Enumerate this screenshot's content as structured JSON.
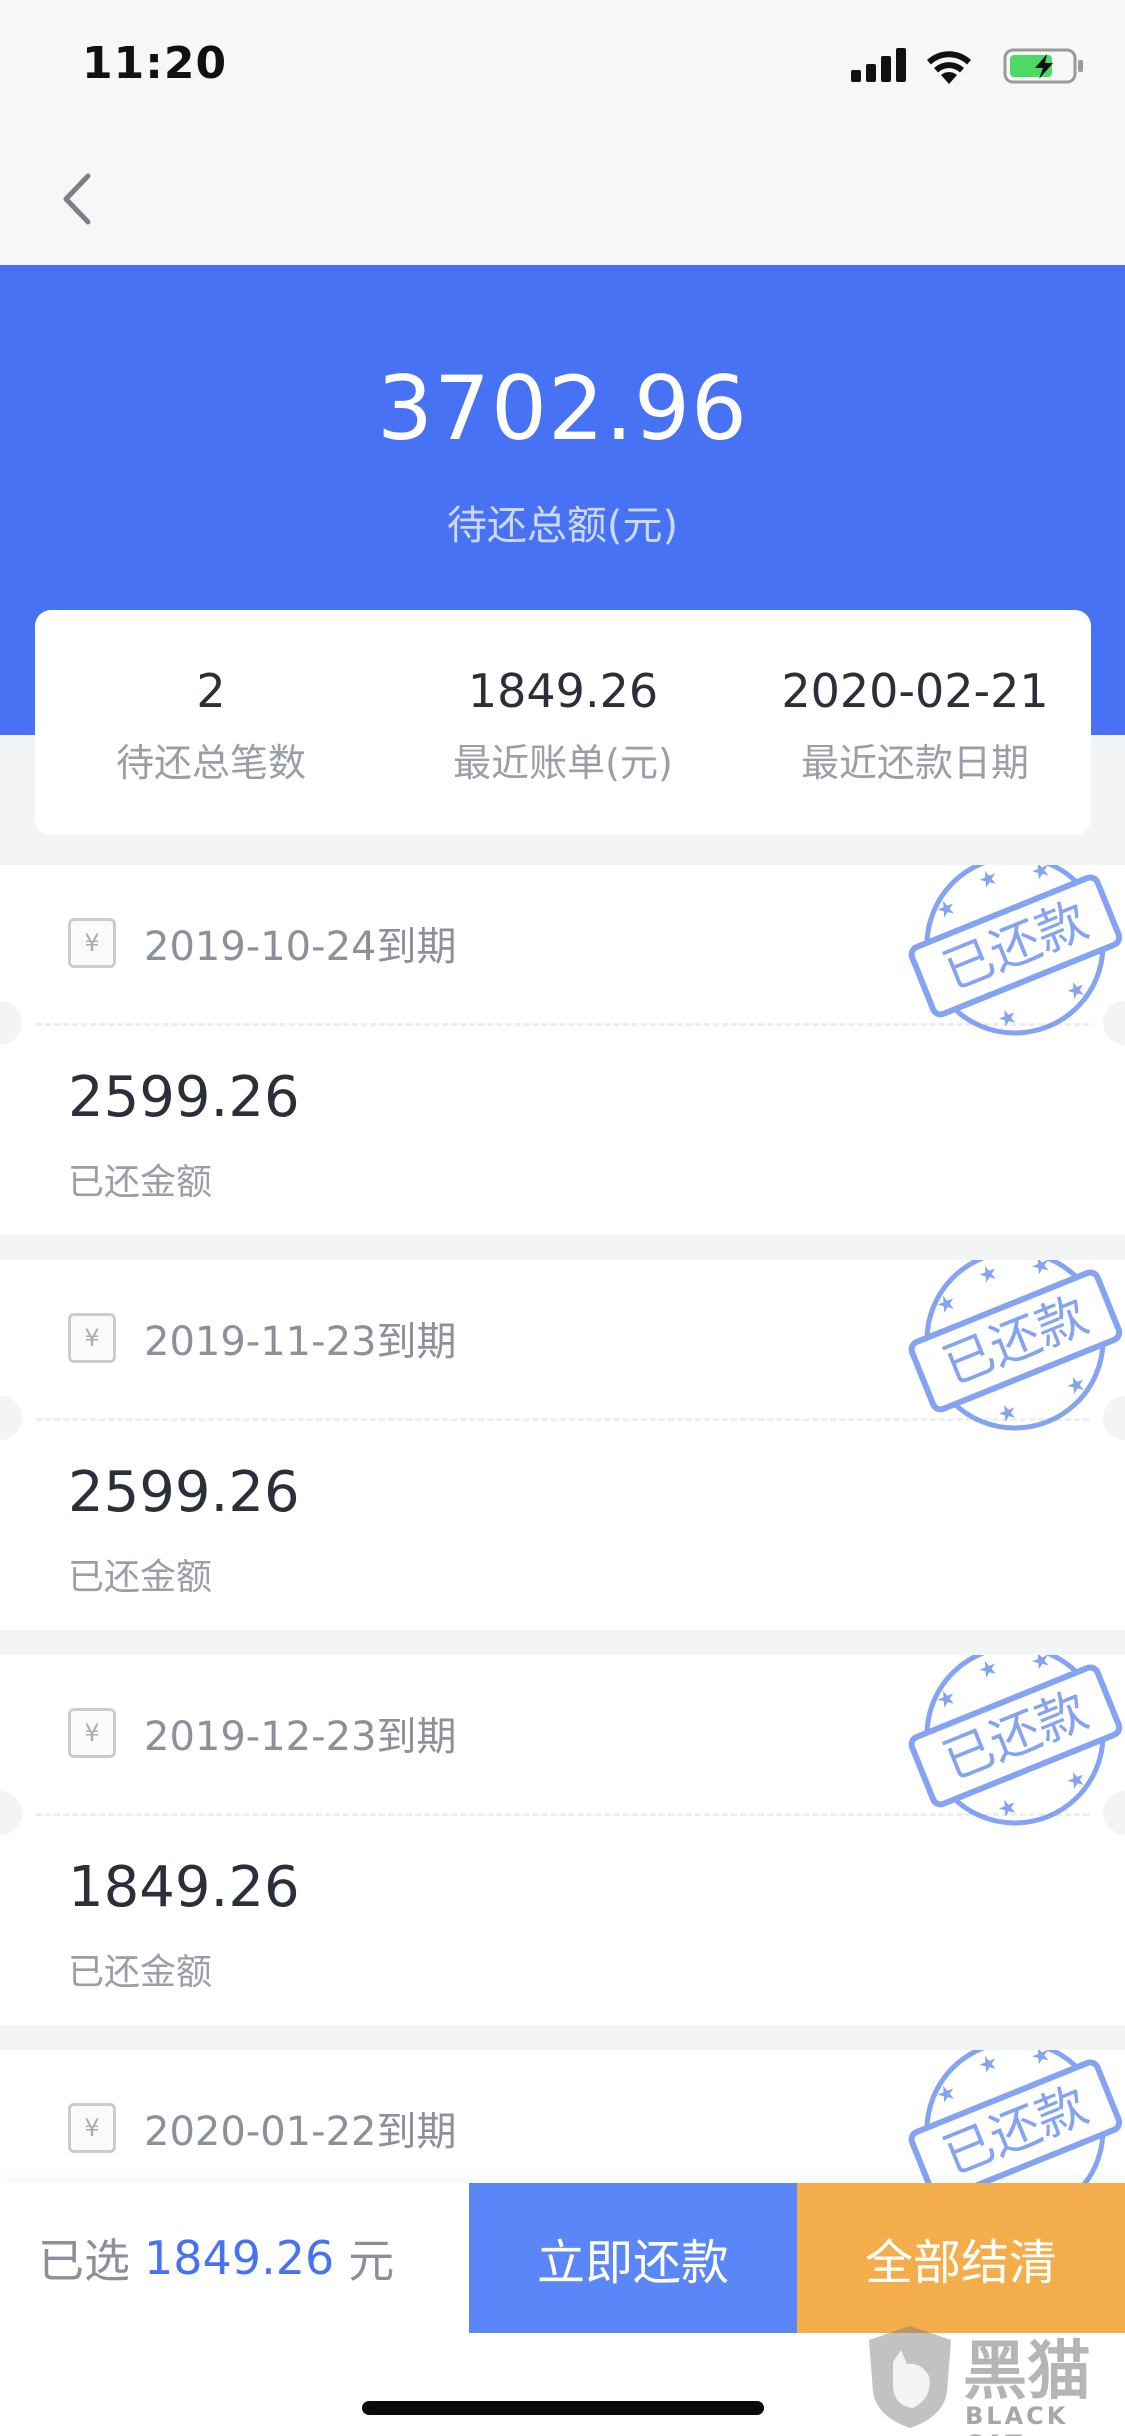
{
  "status_bar": {
    "time": "11:20"
  },
  "hero": {
    "total_amount": "3702.96",
    "total_label": "待还总额(元)"
  },
  "summary": [
    {
      "value": "2",
      "label": "待还总笔数"
    },
    {
      "value": "1849.26",
      "label": "最近账单(元)"
    },
    {
      "value": "2020-02-21",
      "label": "最近还款日期"
    }
  ],
  "bills": [
    {
      "receipt_symbol": "¥",
      "due": "2019-10-24到期",
      "amount": "2599.26",
      "amount_label": "已还金额",
      "stamp": "已还款"
    },
    {
      "receipt_symbol": "¥",
      "due": "2019-11-23到期",
      "amount": "2599.26",
      "amount_label": "已还金额",
      "stamp": "已还款"
    },
    {
      "receipt_symbol": "¥",
      "due": "2019-12-23到期",
      "amount": "1849.26",
      "amount_label": "已还金额",
      "stamp": "已还款"
    },
    {
      "receipt_symbol": "¥",
      "due": "2020-01-22到期",
      "amount": "",
      "amount_label": "",
      "stamp": "已还款"
    }
  ],
  "action_bar": {
    "selected_prefix": "已选",
    "selected_amount": "1849.26",
    "selected_suffix": "元",
    "pay_now": "立即还款",
    "settle_all": "全部结清"
  },
  "watermark": {
    "cn": "黑猫",
    "en": "BLACK CAT"
  },
  "colors": {
    "primary": "#4872f4",
    "pay_button": "#5a86f7",
    "settle_button": "#f3ad4b",
    "stamp": "#5b86f0"
  }
}
